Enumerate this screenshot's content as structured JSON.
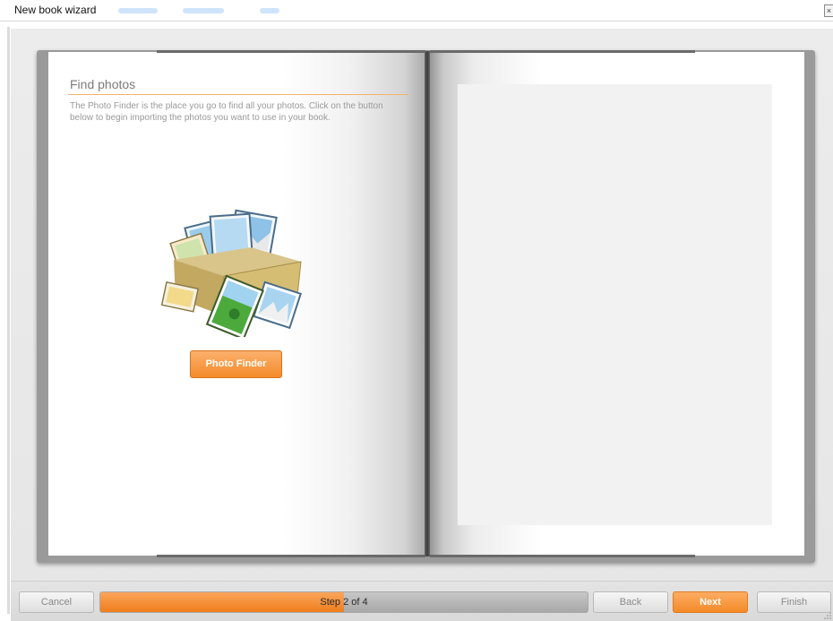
{
  "window": {
    "title": "New book wizard",
    "close_glyph": "×"
  },
  "page_left": {
    "heading": "Find photos",
    "description": "The Photo Finder is the place you go to find all your photos. Click on the button below to begin importing the photos you want to use in your book.",
    "illustration_icon": "photo-box-icon",
    "button_label": "Photo Finder"
  },
  "footer": {
    "cancel_label": "Cancel",
    "progress_text": "Step 2 of 4",
    "progress_fraction": 0.5,
    "back_label": "Back",
    "next_label": "Next",
    "finish_label": "Finish"
  },
  "colors": {
    "accent": "#f48b2a",
    "heading_rule": "#f2b46b",
    "placeholder": "#f2f2f2"
  }
}
